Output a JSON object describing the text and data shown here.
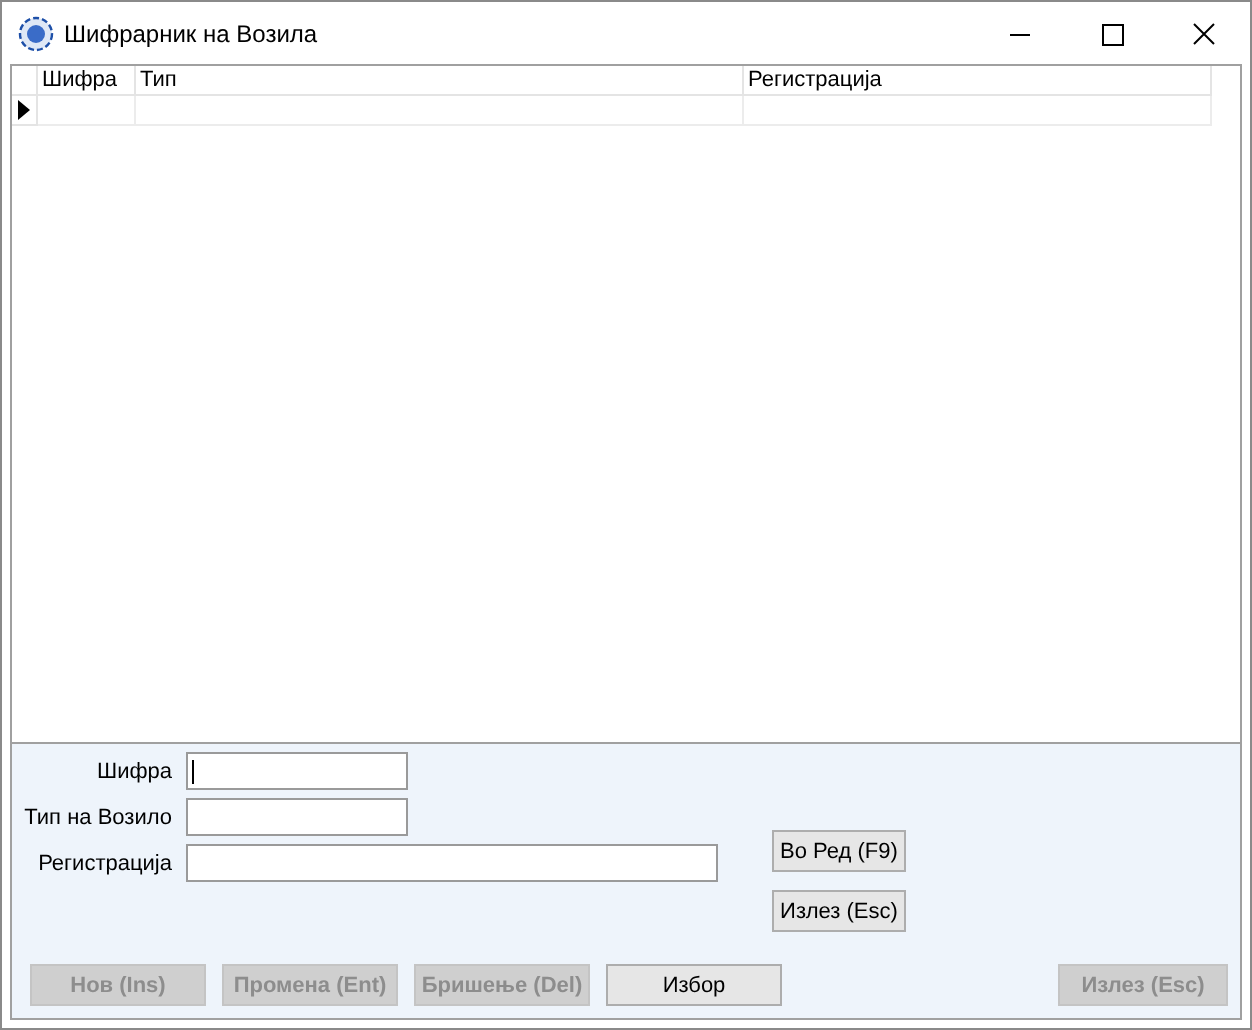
{
  "window": {
    "title": "Шифрарник на Возила"
  },
  "table": {
    "columns": [
      "Шифра",
      "Тип",
      "Регистрација"
    ],
    "rows": [
      {
        "current": true
      }
    ]
  },
  "form": {
    "fields": [
      {
        "label": "Шифра",
        "focused": true
      },
      {
        "label": "Тип на Возило",
        "focused": false
      },
      {
        "label": "Регистрација",
        "focused": false
      }
    ],
    "side_buttons": [
      {
        "label": "Во Ред (F9)",
        "disabled": false
      },
      {
        "label": "Излез (Esc)",
        "disabled": false
      }
    ],
    "bottom_buttons": [
      {
        "label": "Нов (Ins)",
        "disabled": true
      },
      {
        "label": "Промена (Ent)",
        "disabled": true
      },
      {
        "label": "Бришење (Del)",
        "disabled": true
      },
      {
        "label": "Избор",
        "disabled": false
      }
    ],
    "exit_button": {
      "label": "Излез (Esc)",
      "disabled": true
    }
  }
}
